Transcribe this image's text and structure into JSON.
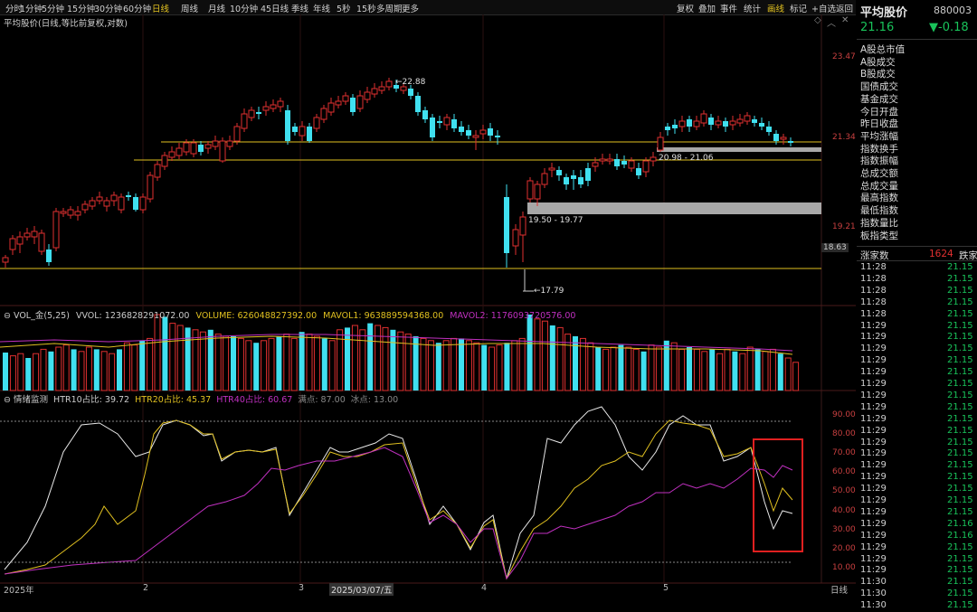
{
  "toolbar": {
    "items": [
      "分时",
      "1分钟",
      "5分钟",
      "15分钟",
      "30分钟",
      "60分钟",
      "日线",
      "周线",
      "月线",
      "10分钟",
      "45日线",
      "季线",
      "年线",
      "5秒",
      "15秒",
      "多周期",
      "更多"
    ],
    "active": "日线",
    "right_items": [
      "复权",
      "叠加",
      "事件",
      "统计",
      "画线",
      "标记",
      "+自选",
      "返回"
    ],
    "right_active": "画线"
  },
  "chart_subtitle": "平均股价(日线,等比前复权,对数)",
  "price_axis": [
    "23.47",
    "21.34",
    "19.21",
    "18.63"
  ],
  "annotations": {
    "high": "22.88",
    "low": "17.79",
    "zone1": "20.98 - 21.06",
    "zone2": "19.50 - 19.77"
  },
  "volume_legend": {
    "name": "VOL_金(5,25)",
    "vvol": "VVOL: 1236828291072.00",
    "volume": "VOLUME: 626048827392.00",
    "mavol1": "MAVOL1: 963889594368.00",
    "mavol2": "MAVOL2: 1176093720576.00"
  },
  "sentiment_legend": {
    "name": "情绪监测",
    "htr10": "HTR10占比: 39.72",
    "htr20": "HTR20占比: 45.37",
    "htr40": "HTR40占比: 60.67",
    "full": "满点: 87.00",
    "ice": "冰点: 13.00"
  },
  "sentiment_axis": [
    "90.00",
    "80.00",
    "70.00",
    "60.00",
    "50.00",
    "40.00",
    "30.00",
    "20.00",
    "10.00"
  ],
  "date_axis": {
    "start": "2025年",
    "m2": "2",
    "m3": "3",
    "cursor": "2025/03/07/五",
    "m4": "4",
    "m5": "5",
    "period": "日线"
  },
  "colors": {
    "up": "#e03030",
    "down": "#40e0f0",
    "yellow": "#e0c020",
    "magenta": "#c030c0",
    "green": "#19c35a"
  },
  "quote": {
    "title": "平均股价",
    "code": "880003",
    "price": "21.16",
    "change": "▼-0.18",
    "labels": [
      "A股总市值",
      "A股成交",
      "B股成交",
      "国债成交",
      "基金成交",
      "今日开盘",
      "昨日收盘",
      "平均涨幅",
      "指数换手",
      "指数振幅",
      "总成交额",
      "总成交量",
      "最高指数",
      "最低指数",
      "指数量比",
      "板指类型"
    ],
    "rise_label": "涨家数",
    "rise_count": "1624",
    "fall_label": "跌家",
    "ticks": [
      [
        "11:28",
        "21.15"
      ],
      [
        "11:28",
        "21.15"
      ],
      [
        "11:28",
        "21.15"
      ],
      [
        "11:28",
        "21.15"
      ],
      [
        "11:28",
        "21.15"
      ],
      [
        "11:29",
        "21.15"
      ],
      [
        "11:29",
        "21.15"
      ],
      [
        "11:29",
        "21.15"
      ],
      [
        "11:29",
        "21.15"
      ],
      [
        "11:29",
        "21.15"
      ],
      [
        "11:29",
        "21.15"
      ],
      [
        "11:29",
        "21.15"
      ],
      [
        "11:29",
        "21.15"
      ],
      [
        "11:29",
        "21.15"
      ],
      [
        "11:29",
        "21.15"
      ],
      [
        "11:29",
        "21.15"
      ],
      [
        "11:29",
        "21.15"
      ],
      [
        "11:29",
        "21.15"
      ],
      [
        "11:29",
        "21.15"
      ],
      [
        "11:29",
        "21.15"
      ],
      [
        "11:29",
        "21.15"
      ],
      [
        "11:29",
        "21.15"
      ],
      [
        "11:29",
        "21.16"
      ],
      [
        "11:29",
        "21.16"
      ],
      [
        "11:29",
        "21.15"
      ],
      [
        "11:29",
        "21.15"
      ],
      [
        "11:29",
        "21.15"
      ],
      [
        "11:30",
        "21.15"
      ],
      [
        "11:30",
        "21.15"
      ],
      [
        "11:30",
        "21.15"
      ]
    ]
  }
}
